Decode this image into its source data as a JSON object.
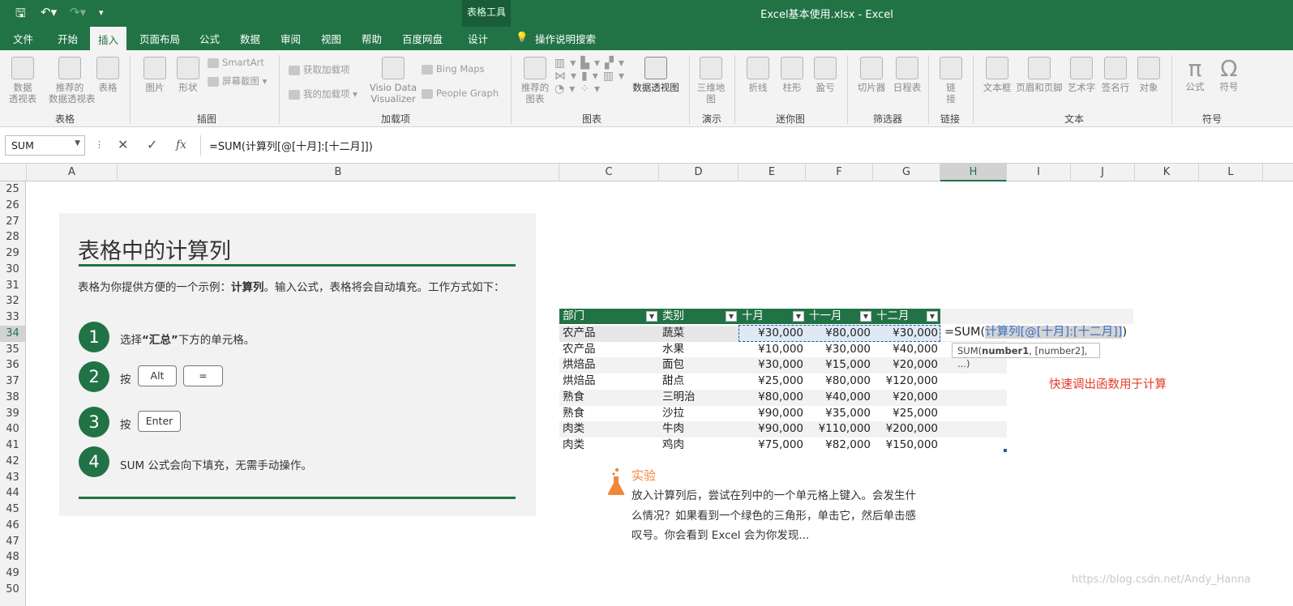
{
  "window": {
    "title": "Excel基本使用.xlsx  -  Excel",
    "context_tab_group": "表格工具"
  },
  "tabs": [
    "文件",
    "开始",
    "插入",
    "页面布局",
    "公式",
    "数据",
    "审阅",
    "视图",
    "帮助",
    "百度网盘",
    "设计"
  ],
  "active_tab": "插入",
  "tell_me": "操作说明搜索",
  "ribbon": {
    "groups": [
      "表格",
      "插图",
      "加载项",
      "图表",
      "演示",
      "迷你图",
      "筛选器",
      "链接",
      "文本",
      "符号"
    ],
    "buttons": {
      "pivot": "数据\n透视表",
      "rec_pivot": "推荐的\n数据透视表",
      "table": "表格",
      "picture": "图片",
      "shapes": "形状",
      "smartart": "SmartArt",
      "screenshot": "屏幕截图",
      "get_addins": "获取加载项",
      "my_addins": "我的加载项",
      "visio": "Visio Data\nVisualizer",
      "bing_maps": "Bing Maps",
      "people_graph": "People Graph",
      "rec_charts": "推荐的\n图表",
      "pivot_chart": "数据透视图",
      "map3d": "三维地\n图",
      "line": "折线",
      "column": "柱形",
      "winloss": "盈亏",
      "slicer": "切片器",
      "timeline": "日程表",
      "link": "链\n接",
      "textbox": "文本框",
      "header_footer": "页眉和页脚",
      "wordart": "艺术字",
      "signature": "签名行",
      "object": "对象",
      "equation": "公式",
      "symbol": "符号"
    }
  },
  "formula_bar": {
    "name_box": "SUM",
    "formula": "=SUM(计算列[@[十月]:[十二月]])"
  },
  "columns": [
    "A",
    "B",
    "C",
    "D",
    "E",
    "F",
    "G",
    "H",
    "I",
    "J",
    "K",
    "L"
  ],
  "selected_column": "H",
  "rows": [
    "25",
    "26",
    "27",
    "28",
    "29",
    "30",
    "31",
    "32",
    "33",
    "34",
    "35",
    "36",
    "37",
    "38",
    "39",
    "40",
    "41",
    "42",
    "43",
    "44",
    "45",
    "46",
    "47",
    "48",
    "49",
    "50"
  ],
  "selected_row": "34",
  "card": {
    "title": "表格中的计算列",
    "desc_1": "表格为你提供方便的一个示例：",
    "desc_bold": "计算列",
    "desc_2": "。输入公式，表格将会自动填充。工作方式如下：",
    "steps": [
      {
        "num": "1",
        "pre": "选择",
        "bold": "“汇总”",
        "post": "下方的单元格。"
      },
      {
        "num": "2",
        "pre": "按",
        "keys": [
          "Alt",
          "="
        ]
      },
      {
        "num": "3",
        "pre": "按",
        "keys": [
          "Enter"
        ]
      },
      {
        "num": "4",
        "text": "SUM 公式会向下填充，无需手动操作。"
      }
    ]
  },
  "table": {
    "headers": [
      "部门",
      "类别",
      "十月",
      "十一月",
      "十二月"
    ],
    "rows": [
      [
        "农产品",
        "蔬菜",
        "¥30,000",
        "¥80,000",
        "¥30,000"
      ],
      [
        "农产品",
        "水果",
        "¥10,000",
        "¥30,000",
        "¥40,000"
      ],
      [
        "烘焙品",
        "面包",
        "¥30,000",
        "¥15,000",
        "¥20,000"
      ],
      [
        "烘焙品",
        "甜点",
        "¥25,000",
        "¥80,000",
        "¥120,000"
      ],
      [
        "熟食",
        "三明治",
        "¥80,000",
        "¥40,000",
        "¥20,000"
      ],
      [
        "熟食",
        "沙拉",
        "¥90,000",
        "¥35,000",
        "¥25,000"
      ],
      [
        "肉类",
        "牛肉",
        "¥90,000",
        "¥110,000",
        "¥200,000"
      ],
      [
        "肉类",
        "鸡肉",
        "¥75,000",
        "¥82,000",
        "¥150,000"
      ]
    ],
    "editing_prefix": "=SUM(",
    "editing_ref": "计算列[@[十月]:[十二月]]",
    "editing_suffix": ")",
    "tooltip_pre": "SUM(",
    "tooltip_bold": "number1",
    "tooltip_post": ", [number2], ...)"
  },
  "quick_note": "快速调出函数用于计算",
  "experiment": {
    "title": "实验",
    "text": "放入计算列后，尝试在列中的一个单元格上键入。会发生什么情况？如果看到一个绿色的三角形，单击它，然后单击感叹号。你会看到 Excel 会为你发现..."
  },
  "watermark": "https://blog.csdn.net/Andy_Hanna",
  "colors": {
    "accent": "#217346",
    "note": "#e63a2b",
    "lab": "#f0883a"
  }
}
